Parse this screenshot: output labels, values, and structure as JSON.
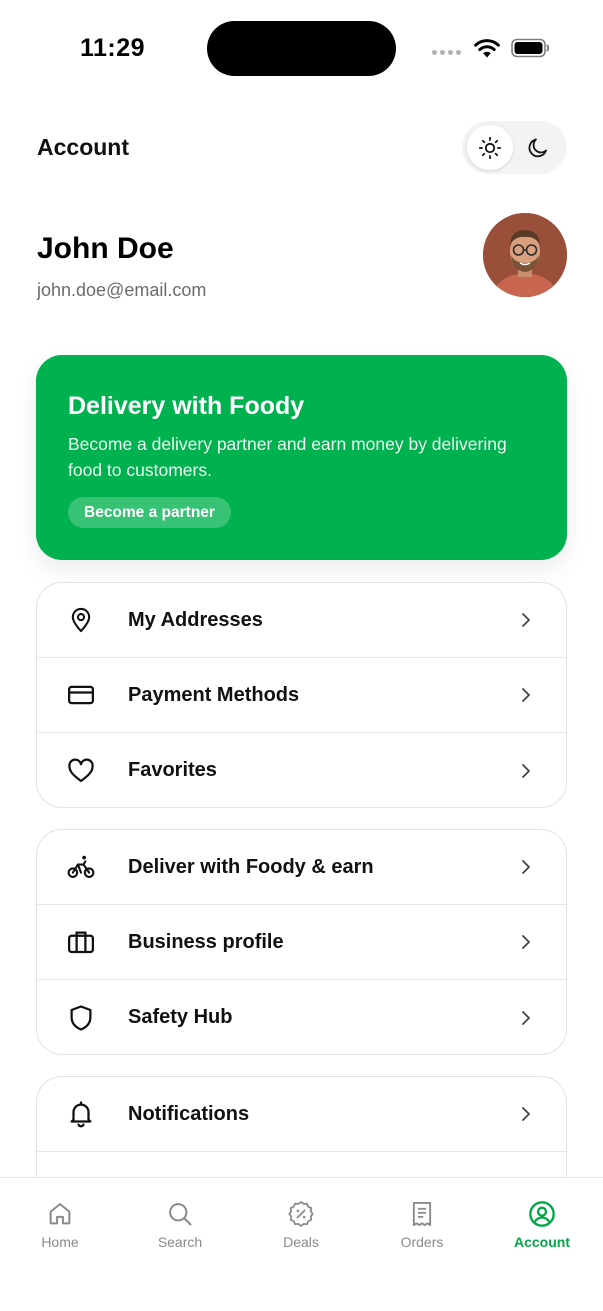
{
  "status_bar": {
    "time": "11:29"
  },
  "header": {
    "title": "Account"
  },
  "theme_toggle": {
    "options": [
      "light",
      "dark"
    ],
    "selected": "light"
  },
  "profile": {
    "name": "John Doe",
    "email": "john.doe@email.com"
  },
  "promo": {
    "title": "Delivery with Foody",
    "description": "Become a delivery partner and earn money by delivering food to customers.",
    "button_label": "Become a partner",
    "color": "#00b14f"
  },
  "menu_groups": [
    {
      "items": [
        {
          "label": "My Addresses",
          "icon": "location-pin-icon"
        },
        {
          "label": "Payment Methods",
          "icon": "credit-card-icon"
        },
        {
          "label": "Favorites",
          "icon": "heart-icon"
        }
      ]
    },
    {
      "items": [
        {
          "label": "Deliver with Foody & earn",
          "icon": "bike-icon"
        },
        {
          "label": "Business profile",
          "icon": "briefcase-icon"
        },
        {
          "label": "Safety Hub",
          "icon": "shield-icon"
        }
      ]
    },
    {
      "items": [
        {
          "label": "Notifications",
          "icon": "bell-icon"
        }
      ]
    }
  ],
  "bottom_nav": {
    "items": [
      {
        "label": "Home",
        "icon": "home-icon"
      },
      {
        "label": "Search",
        "icon": "search-icon"
      },
      {
        "label": "Deals",
        "icon": "deals-badge-icon"
      },
      {
        "label": "Orders",
        "icon": "receipt-icon"
      },
      {
        "label": "Account",
        "icon": "user-circle-icon"
      }
    ],
    "active": "Account",
    "active_color": "#00a846"
  }
}
